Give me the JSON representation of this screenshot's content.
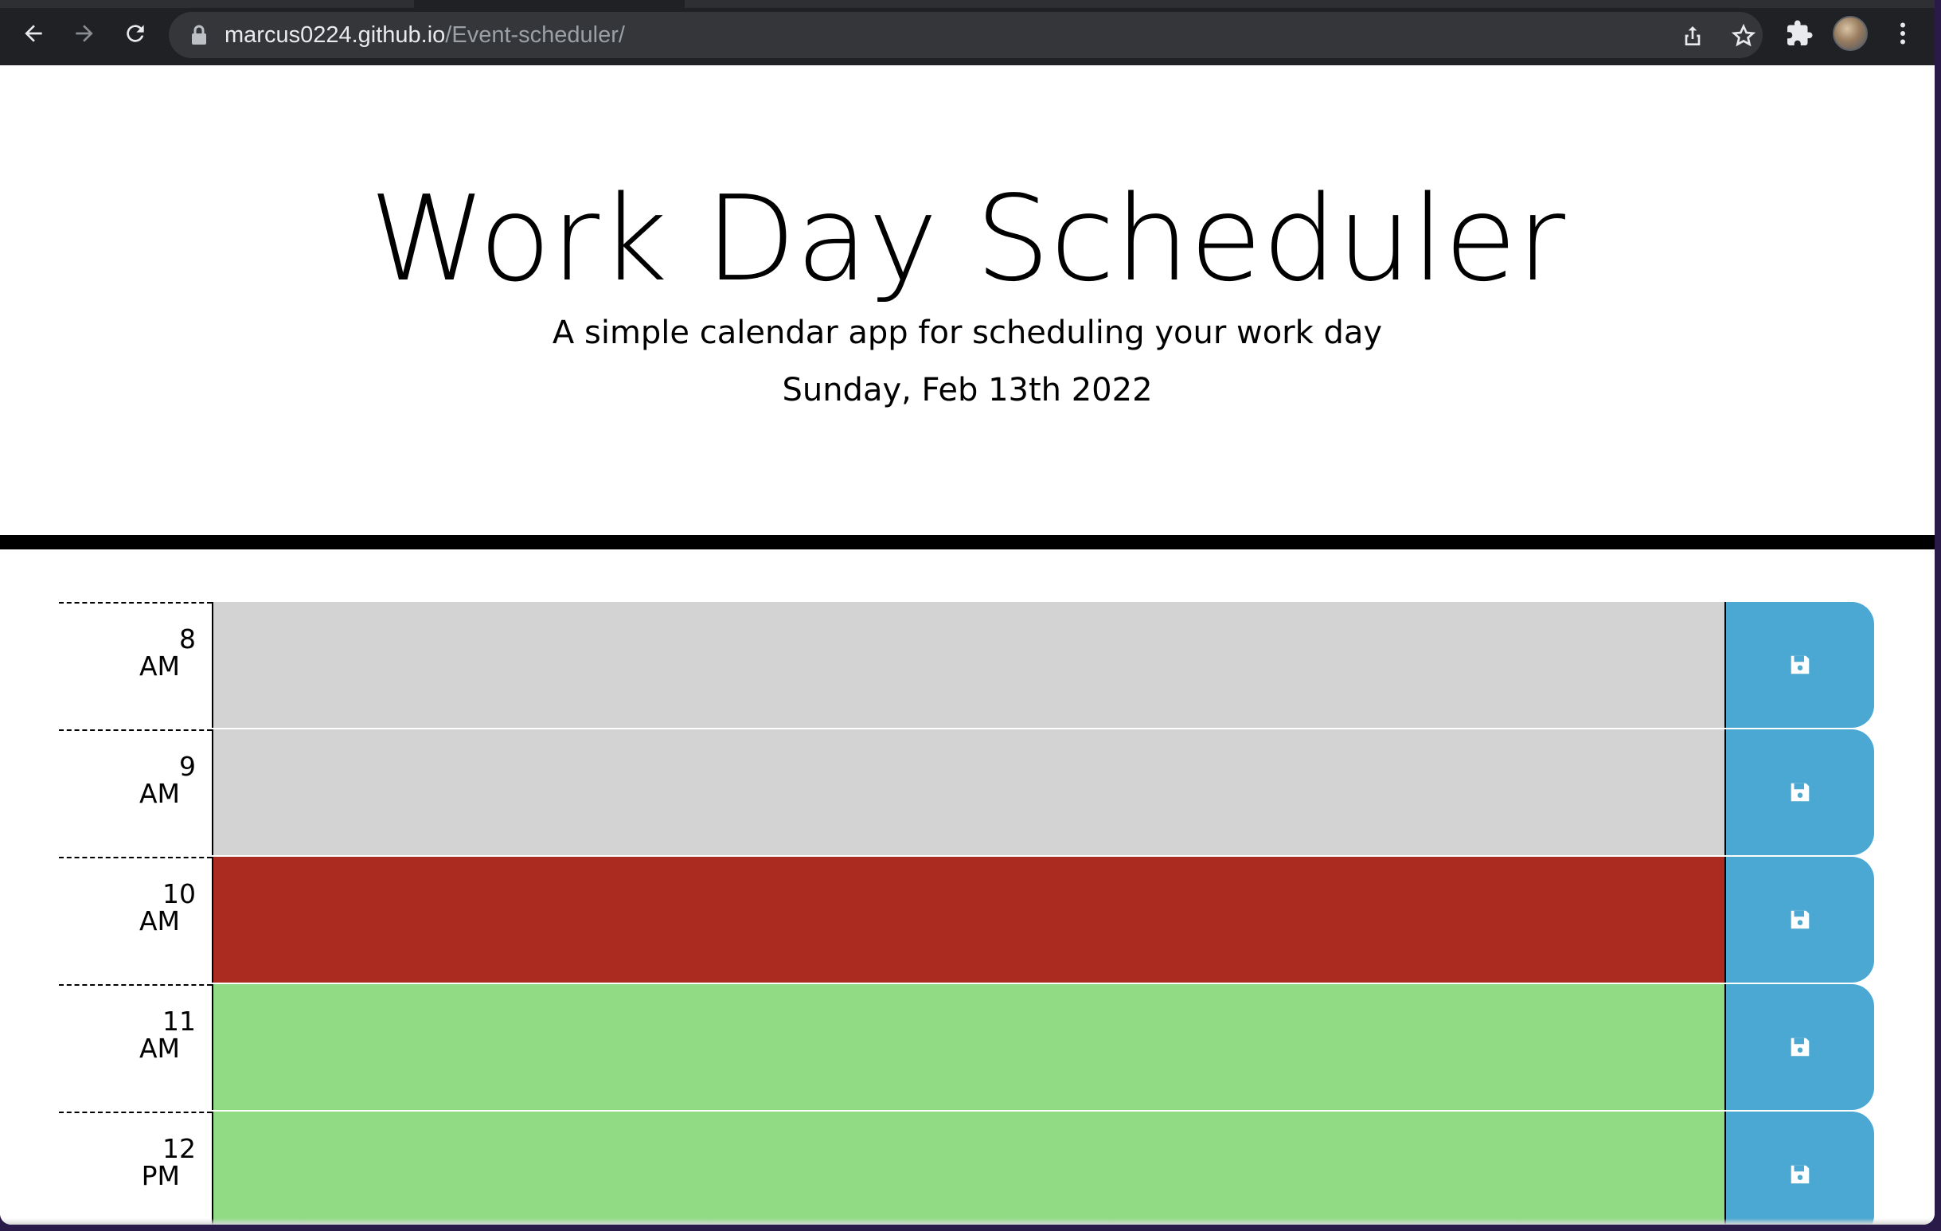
{
  "browser": {
    "url_host": "marcus0224.github.io",
    "url_path": "/Event-scheduler/",
    "icons": {
      "back": "back-arrow-icon",
      "forward": "forward-arrow-icon",
      "reload": "reload-icon",
      "lock": "lock-icon",
      "share": "share-icon",
      "bookmark": "star-icon",
      "extensions": "puzzle-icon",
      "menu": "kebab-menu-icon"
    }
  },
  "header": {
    "title": "Work Day Scheduler",
    "lead": "A simple calendar app for scheduling your work day",
    "current_day": "Sunday, Feb 13th 2022"
  },
  "timeblocks": [
    {
      "hour": "8",
      "period": "AM",
      "status": "past",
      "text": ""
    },
    {
      "hour": "9",
      "period": "AM",
      "status": "past",
      "text": ""
    },
    {
      "hour": "10",
      "period": "AM",
      "status": "present",
      "text": ""
    },
    {
      "hour": "11",
      "period": "AM",
      "status": "future",
      "text": ""
    },
    {
      "hour": "12",
      "period": "PM",
      "status": "future",
      "text": ""
    }
  ],
  "colors": {
    "past": "#d3d3d3",
    "present": "#ab2b21",
    "future": "#91db84",
    "save_button": "#4aa8d2"
  }
}
